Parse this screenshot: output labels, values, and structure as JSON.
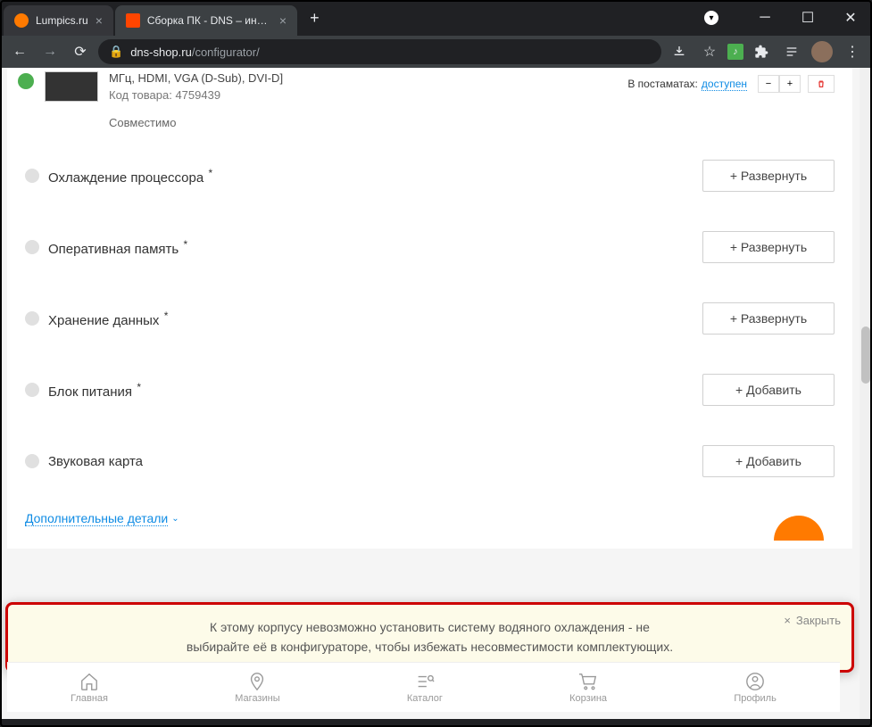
{
  "browser": {
    "tabs": [
      {
        "title": "Lumpics.ru",
        "favicon": "#ff7a00"
      },
      {
        "title": "Сборка ПК - DNS – интернет ма",
        "favicon": "#ff4500"
      }
    ],
    "url_host": "dns-shop.ru",
    "url_path": "/configurator/"
  },
  "product": {
    "spec": "МГц, HDMI, VGA (D-Sub), DVI-D]",
    "code_label": "Код товара:",
    "code": "4759439",
    "compat": "Совместимо",
    "avail_label": "В постаматах:",
    "avail_value": "доступен"
  },
  "categories": [
    {
      "name": "Охлаждение процессора",
      "required": true,
      "button": "+ Развернуть"
    },
    {
      "name": "Оперативная память",
      "required": true,
      "button": "+ Развернуть"
    },
    {
      "name": "Хранение данных",
      "required": true,
      "button": "+ Развернуть"
    },
    {
      "name": "Блок питания",
      "required": true,
      "button": "+ Добавить"
    },
    {
      "name": "Звуковая карта",
      "required": false,
      "button": "+ Добавить"
    }
  ],
  "more_label": "Дополнительные детали",
  "warning": {
    "text": "К этому корпусу невозможно установить систему водяного охлаждения - не выбирайте её в конфигураторе, чтобы избежать несовместимости комплектующих.",
    "close": "Закрыть"
  },
  "nav": {
    "home": "Главная",
    "stores": "Магазины",
    "catalog": "Каталог",
    "cart": "Корзина",
    "profile": "Профиль"
  }
}
